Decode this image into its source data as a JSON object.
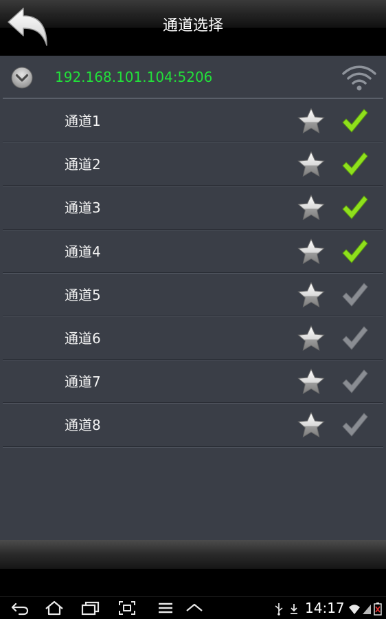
{
  "titlebar": {
    "title": "通道选择",
    "back_icon": "back-arrow-icon"
  },
  "device": {
    "address": "192.168.101.104:5206",
    "expand_icon": "chevron-down-icon",
    "signal_icon": "wifi-icon"
  },
  "channels": [
    {
      "label": "通道1",
      "selected": true
    },
    {
      "label": "通道2",
      "selected": true
    },
    {
      "label": "通道3",
      "selected": true
    },
    {
      "label": "通道4",
      "selected": true
    },
    {
      "label": "通道5",
      "selected": false
    },
    {
      "label": "通道6",
      "selected": false
    },
    {
      "label": "通道7",
      "selected": false
    },
    {
      "label": "通道8",
      "selected": false
    }
  ],
  "colors": {
    "ip_text": "#22e03a",
    "check_on": "#8fe01c",
    "check_off": "#8a8d93",
    "list_bg": "#3a3e47"
  },
  "statusbar": {
    "time": "14:17",
    "nav_icons": [
      "back-icon",
      "home-icon",
      "recent-apps-icon",
      "screenshot-icon",
      "menu-icon",
      "hide-keyboard-icon"
    ],
    "status_icons": [
      "usb-icon",
      "download-icon",
      "wifi-icon",
      "signal-icon",
      "battery-icon"
    ]
  }
}
